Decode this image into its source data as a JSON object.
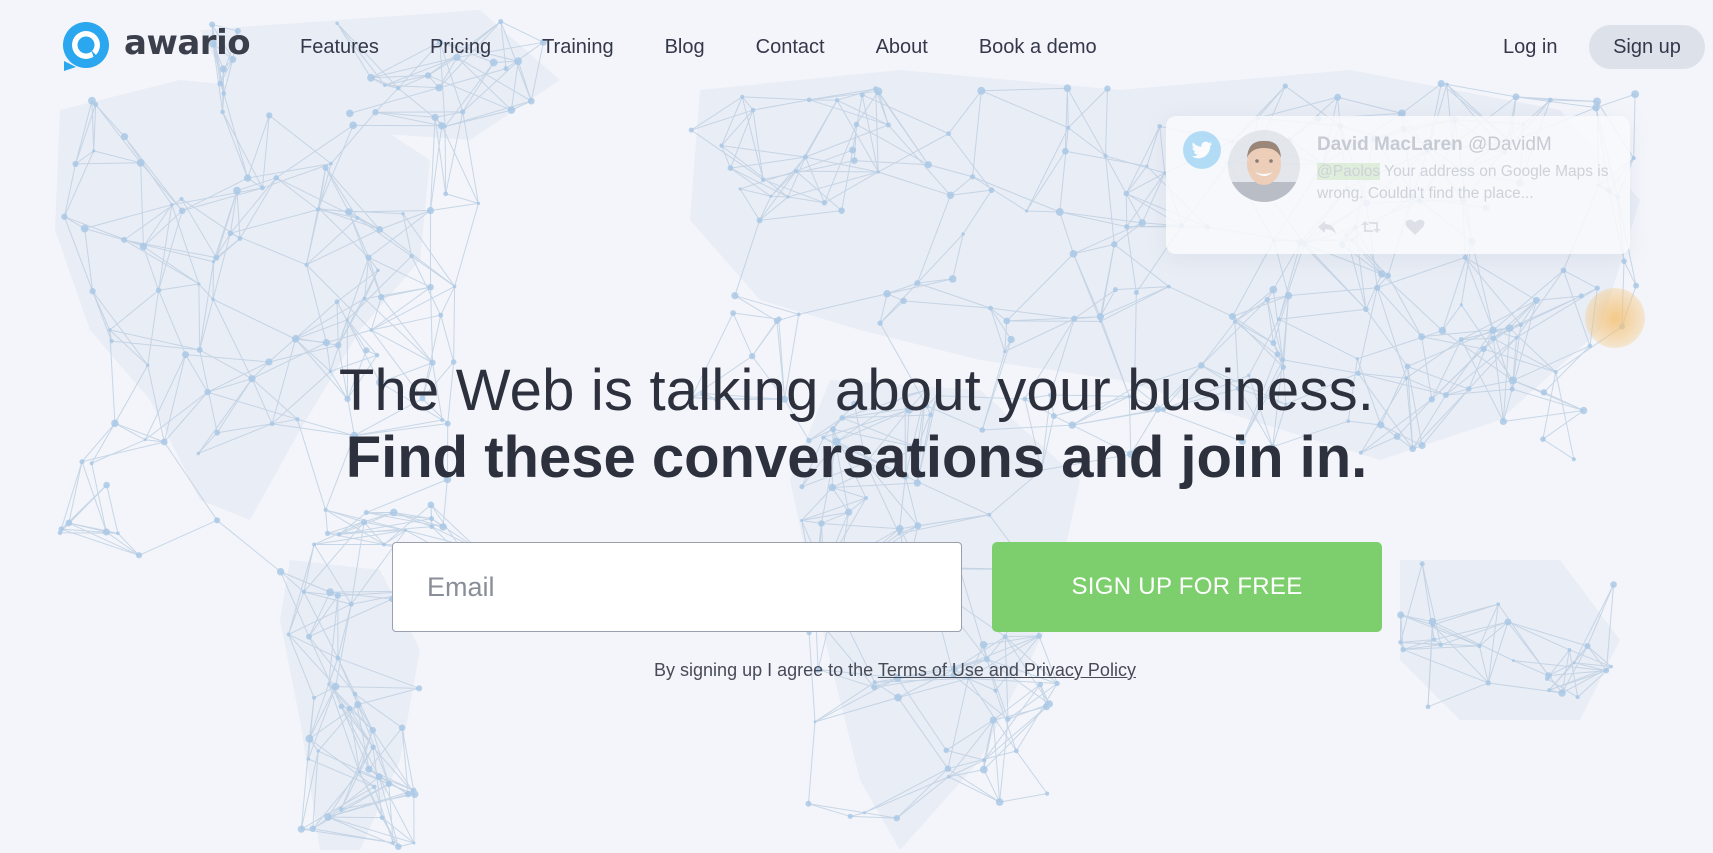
{
  "brand": {
    "name": "awario",
    "logo_color": "#2aa7ee"
  },
  "nav": {
    "items": [
      {
        "label": "Features"
      },
      {
        "label": "Pricing"
      },
      {
        "label": "Training"
      },
      {
        "label": "Blog"
      },
      {
        "label": "Contact"
      },
      {
        "label": "About"
      },
      {
        "label": "Book a demo"
      }
    ],
    "login_label": "Log in",
    "signup_label": "Sign up"
  },
  "tweet": {
    "name": "David MacLaren",
    "handle": "@DavidM",
    "mention": "@Paolos",
    "text": " Your address on Google Maps is wrong. Couldn't find the place..."
  },
  "hero": {
    "line1": "The Web is talking about your business.",
    "line2": "Find these conversations and join in."
  },
  "signup_form": {
    "email_placeholder": "Email",
    "email_value": "",
    "button_label": "SIGN UP FOR FREE",
    "button_color": "#7dcf6d"
  },
  "terms": {
    "prefix": "By signing up I agree to the ",
    "link_label": "Terms of Use and Privacy Policy"
  },
  "colors": {
    "background": "#f3f5fa",
    "text": "#2d303d",
    "map_lines": "#b9cce0"
  }
}
